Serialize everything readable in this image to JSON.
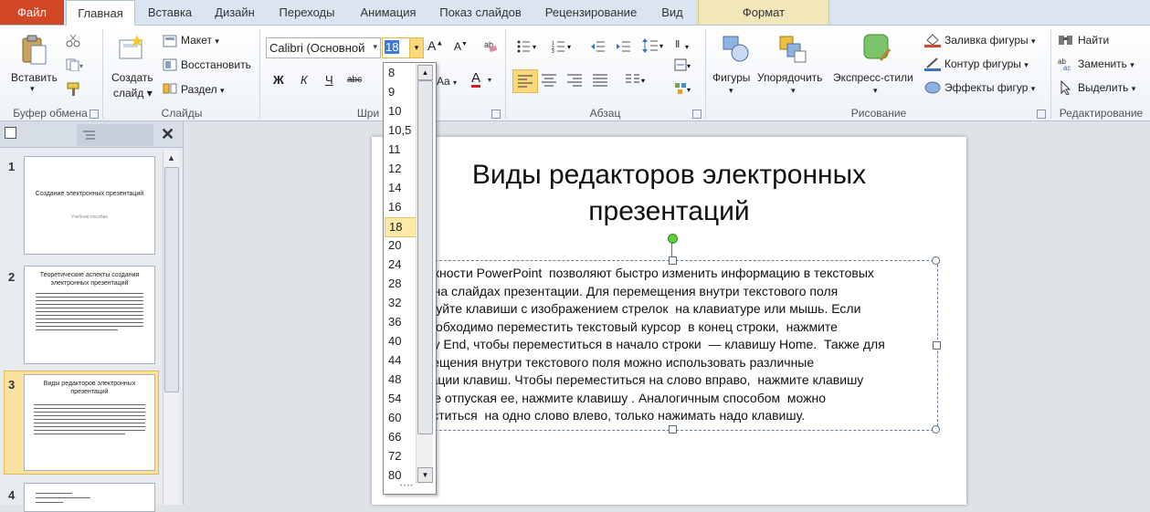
{
  "tabs": {
    "file": "Файл",
    "home": "Главная",
    "insert": "Вставка",
    "design": "Дизайн",
    "transitions": "Переходы",
    "animation": "Анимация",
    "slideshow": "Показ слайдов",
    "review": "Рецензирование",
    "view": "Вид",
    "format": "Формат"
  },
  "ribbon": {
    "clipboard": {
      "paste": "Вставить",
      "group": "Буфер обмена"
    },
    "slides": {
      "new_slide_line1": "Создать",
      "new_slide_line2": "слайд",
      "layout": "Макет",
      "reset": "Восстановить",
      "section": "Раздел",
      "group": "Слайды"
    },
    "font": {
      "font_name": "Calibri (Основной",
      "font_size": "18",
      "bold": "Ж",
      "italic": "К",
      "underline": "Ч",
      "strike": "abc",
      "change_case": "Aa",
      "font_color": "А",
      "group": "Шри"
    },
    "paragraph": {
      "group": "Абзац"
    },
    "drawing": {
      "shapes": "Фигуры",
      "arrange": "Упорядочить",
      "quick_styles": "Экспресс-стили",
      "fill": "Заливка фигуры",
      "outline": "Контур фигуры",
      "effects": "Эффекты фигур",
      "group": "Рисование"
    },
    "editing": {
      "find": "Найти",
      "replace": "Заменить",
      "select": "Выделить",
      "group": "Редактирование"
    }
  },
  "font_size_list": [
    "8",
    "9",
    "10",
    "10,5",
    "11",
    "12",
    "14",
    "16",
    "18",
    "20",
    "24",
    "28",
    "32",
    "36",
    "40",
    "44",
    "48",
    "54",
    "60",
    "66",
    "72",
    "80"
  ],
  "font_size_selected": "18",
  "slides": [
    {
      "num": "1",
      "title": "Создание  электронных презентаций",
      "subtitle": "Учебное  пособие"
    },
    {
      "num": "2",
      "title": "Теоретические аспекты создания электронных презентаций"
    },
    {
      "num": "3",
      "title": "Виды редакторов электронных презентаций"
    },
    {
      "num": "4",
      "title": ""
    }
  ],
  "active_slide": {
    "title": "Виды редакторов электронных\nпрезентаций",
    "body": "зможности PowerPoint  позволяют быстро изменить информацию в текстовых\nлях на слайдах презентации. Для перемещения внутри текстового поля\nользуйте клавиши с изображением стрелок  на клавиатуре или мышь. Если\nм необходимо переместить текстовый курсор  в конец строки,  нажмите\nвишу End, чтобы переместиться в начало строки  — клавишу Home.  Также для\nремещения внутри текстового поля можно использовать различные\nбинации клавиш. Чтобы переместиться на слово вправо,  нажмите клавишу\n и, не отпуская ее, нажмите клавишу . Аналогичным способом  можно\nеместиться  на одно слово влево, только нажимать надо клавишу."
  },
  "colors": {
    "file_tab": "#d24726",
    "format_tab": "#f1e7b8",
    "selection": "#fde9a8"
  }
}
